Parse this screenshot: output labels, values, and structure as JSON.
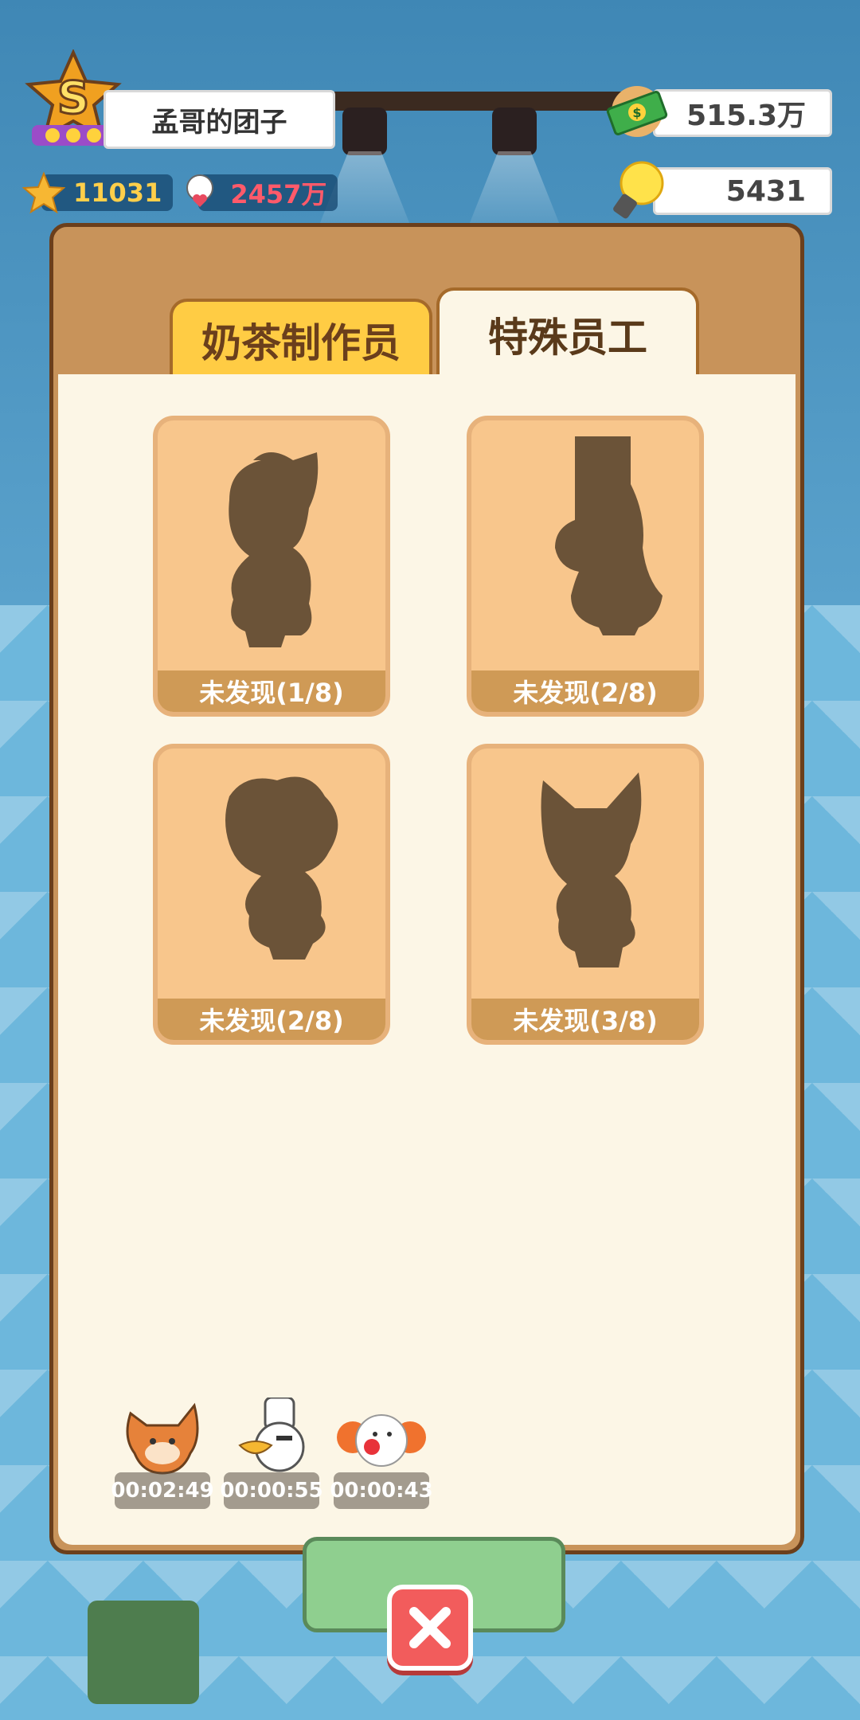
{
  "hud": {
    "player_name": "孟哥的团子",
    "rank_letter": "S",
    "stars": "11031",
    "fans": "2457万",
    "money": "515.3万",
    "ideas": "5431"
  },
  "tabs": {
    "left": "奶茶制作员",
    "right": "特殊员工"
  },
  "cards": [
    {
      "label": "未发现(1/8)"
    },
    {
      "label": "未发现(2/8)"
    },
    {
      "label": "未发现(2/8)"
    },
    {
      "label": "未发现(3/8)"
    }
  ],
  "timers": [
    {
      "time": "00:02:49",
      "icon": "fox-head-icon"
    },
    {
      "time": "00:00:55",
      "icon": "chef-bird-head-icon"
    },
    {
      "time": "00:00:43",
      "icon": "clown-head-icon"
    }
  ],
  "colors": {
    "silhouette": "#6b5338",
    "card_bg": "#f8c68c",
    "tab_active": "#ffcc44",
    "close_red": "#f25c5c"
  }
}
